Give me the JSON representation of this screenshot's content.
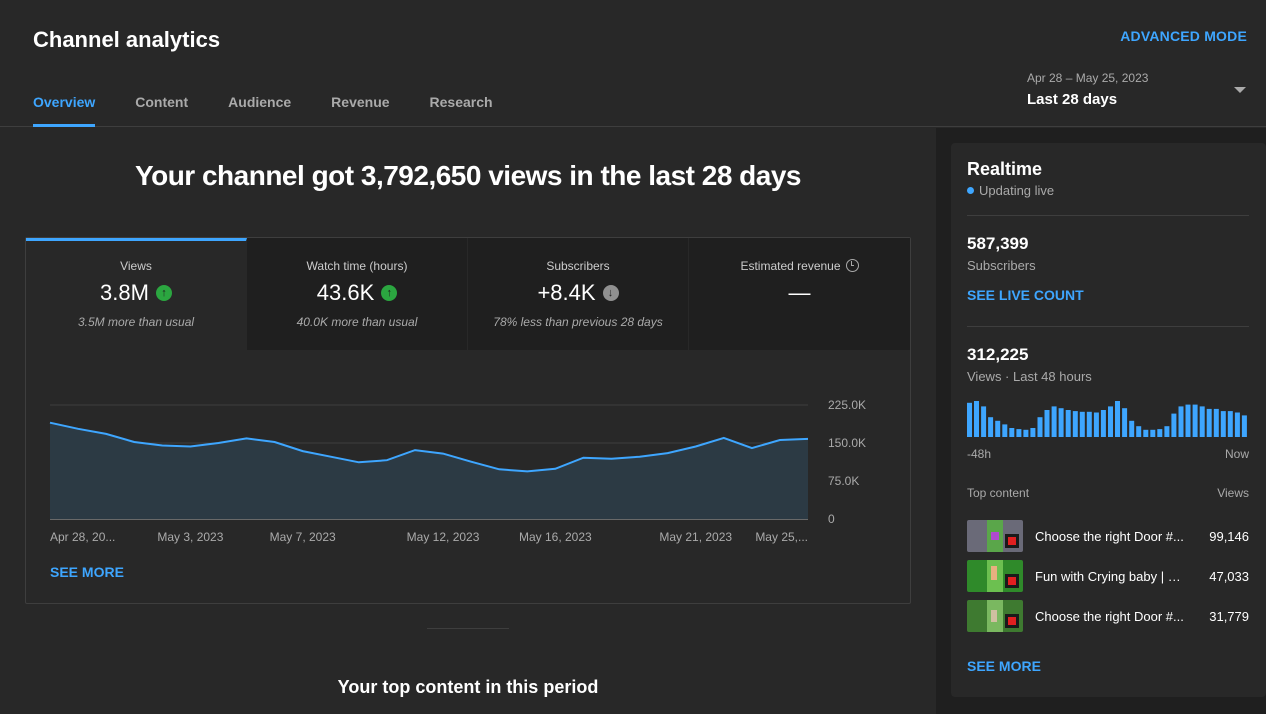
{
  "header": {
    "title": "Channel analytics",
    "advanced_mode": "ADVANCED MODE",
    "tabs": [
      {
        "label": "Overview",
        "active": true
      },
      {
        "label": "Content"
      },
      {
        "label": "Audience"
      },
      {
        "label": "Revenue"
      },
      {
        "label": "Research"
      }
    ],
    "date_range": "Apr 28 – May 25, 2023",
    "date_label": "Last 28 days"
  },
  "main": {
    "headline": "Your channel got 3,792,650 views in the last 28 days",
    "metrics": [
      {
        "label": "Views",
        "value": "3.8M",
        "trend": "up",
        "sub": "3.5M more than usual"
      },
      {
        "label": "Watch time (hours)",
        "value": "43.6K",
        "trend": "up",
        "sub": "40.0K more than usual"
      },
      {
        "label": "Subscribers",
        "value": "+8.4K",
        "trend": "down",
        "sub": "78% less than previous 28 days"
      },
      {
        "label": "Estimated revenue",
        "value": "—",
        "trend": "none",
        "sub": ""
      }
    ],
    "see_more": "SEE MORE",
    "top_content_title": "Your top content in this period"
  },
  "chart_data": {
    "type": "area",
    "series": [
      {
        "name": "Views",
        "values": [
          190000,
          178000,
          168000,
          152000,
          145000,
          143000,
          150000,
          159000,
          152000,
          134000,
          123000,
          112000,
          116000,
          136000,
          129000,
          113000,
          98000,
          94000,
          99000,
          121000,
          119000,
          123000,
          130000,
          143000,
          160000,
          140000,
          156000,
          158000
        ]
      }
    ],
    "ylim": [
      0,
      225000
    ],
    "y_ticks": [
      "0",
      "75.0K",
      "150.0K",
      "225.0K"
    ],
    "x_labels": [
      {
        "index": 0,
        "label": "Apr 28, 20..."
      },
      {
        "index": 5,
        "label": "May 3, 2023"
      },
      {
        "index": 9,
        "label": "May 7, 2023"
      },
      {
        "index": 14,
        "label": "May 12, 2023"
      },
      {
        "index": 18,
        "label": "May 16, 2023"
      },
      {
        "index": 23,
        "label": "May 21, 2023"
      },
      {
        "index": 27,
        "label": "May 25,..."
      }
    ],
    "line_color": "#3ea6ff",
    "grid": true
  },
  "realtime": {
    "title": "Realtime",
    "status": "Updating live",
    "subscribers_value": "587,399",
    "subscribers_label": "Subscribers",
    "see_live_count": "SEE LIVE COUNT",
    "views_value": "312,225",
    "views_label": "Views · Last 48 hours",
    "hourly_bars": [
      0.95,
      1.0,
      0.85,
      0.55,
      0.45,
      0.35,
      0.25,
      0.22,
      0.2,
      0.25,
      0.55,
      0.75,
      0.85,
      0.8,
      0.75,
      0.72,
      0.7,
      0.7,
      0.68,
      0.75,
      0.85,
      1.0,
      0.8,
      0.45,
      0.3,
      0.2,
      0.2,
      0.22,
      0.3,
      0.65,
      0.85,
      0.9,
      0.9,
      0.85,
      0.78,
      0.78,
      0.72,
      0.72,
      0.68,
      0.6
    ],
    "bar_color": "#3ea6ff",
    "axis_left": "-48h",
    "axis_right": "Now",
    "top_content_label": "Top content",
    "views_col_label": "Views",
    "top_content": [
      {
        "title": "Choose the right Door #...",
        "views": "99,146"
      },
      {
        "title": "Fun with Crying baby | F...",
        "views": "47,033"
      },
      {
        "title": "Choose the right Door #...",
        "views": "31,779"
      }
    ],
    "see_more": "SEE MORE"
  }
}
